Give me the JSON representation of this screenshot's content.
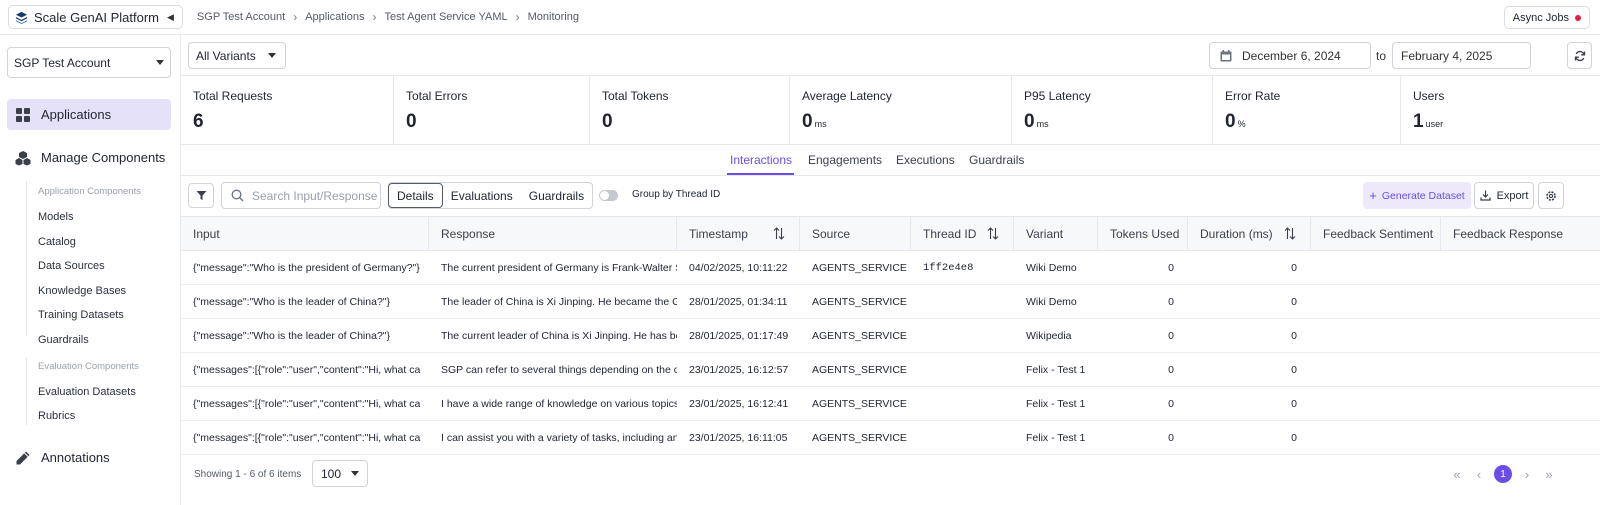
{
  "brand": {
    "name": "Scale GenAI Platform"
  },
  "breadcrumbs": [
    "SGP Test Account",
    "Applications",
    "Test Agent Service YAML",
    "Monitoring"
  ],
  "async_jobs": {
    "label": "Async Jobs"
  },
  "sidebar": {
    "account": "SGP Test Account",
    "applications": "Applications",
    "manage_components": "Manage Components",
    "app_components_header": "Application Components",
    "app_components": [
      "Models",
      "Catalog",
      "Data Sources",
      "Knowledge Bases",
      "Training Datasets",
      "Guardrails"
    ],
    "eval_components_header": "Evaluation Components",
    "eval_components": [
      "Evaluation Datasets",
      "Rubrics"
    ],
    "annotations": "Annotations"
  },
  "filters": {
    "variants": "All Variants",
    "date_from": "December 6, 2024",
    "to_label": "to",
    "date_to": "February 4, 2025"
  },
  "stats": [
    {
      "label": "Total Requests",
      "value": "6",
      "unit": ""
    },
    {
      "label": "Total Errors",
      "value": "0",
      "unit": ""
    },
    {
      "label": "Total Tokens",
      "value": "0",
      "unit": ""
    },
    {
      "label": "Average Latency",
      "value": "0",
      "unit": "ms"
    },
    {
      "label": "P95 Latency",
      "value": "0",
      "unit": "ms"
    },
    {
      "label": "Error Rate",
      "value": "0",
      "unit": "%"
    },
    {
      "label": "Users",
      "value": "1",
      "unit": "user"
    }
  ],
  "tabs": [
    "Interactions",
    "Engagements",
    "Executions",
    "Guardrails"
  ],
  "toolbar": {
    "search_placeholder": "Search Input/Response",
    "segments": [
      "Details",
      "Evaluations",
      "Guardrails"
    ],
    "group_by_label": "Group by Thread ID",
    "generate_label": "Generate Dataset",
    "export_label": "Export"
  },
  "table": {
    "columns": [
      "Input",
      "Response",
      "Timestamp",
      "Source",
      "Thread ID",
      "Variant",
      "Tokens Used",
      "Duration (ms)",
      "Feedback Sentiment",
      "Feedback Response"
    ],
    "rows": [
      [
        "{\"message\":\"Who is the president of Germany?\"}",
        "The current president of Germany is Frank-Walter S",
        "04/02/2025, 10:11:22",
        "AGENTS_SERVICE",
        "1ff2e4e8",
        "Wiki Demo",
        "0",
        "0",
        "",
        ""
      ],
      [
        "{\"message\":\"Who is the leader of China?\"}",
        "The leader of China is Xi Jinping. He became the G",
        "28/01/2025, 01:34:11",
        "AGENTS_SERVICE",
        "",
        "Wiki Demo",
        "0",
        "0",
        "",
        ""
      ],
      [
        "{\"message\":\"Who is the leader of China?\"}",
        "The current leader of China is Xi Jinping. He has be",
        "28/01/2025, 01:17:49",
        "AGENTS_SERVICE",
        "",
        "Wikipedia",
        "0",
        "0",
        "",
        ""
      ],
      [
        "{\"messages\":[{\"role\":\"user\",\"content\":\"Hi, what ca",
        "SGP can refer to several things depending on the c",
        "23/01/2025, 16:12:57",
        "AGENTS_SERVICE",
        "",
        "Felix - Test 1",
        "0",
        "0",
        "",
        ""
      ],
      [
        "{\"messages\":[{\"role\":\"user\",\"content\":\"Hi, what ca",
        "I have a wide range of knowledge on various topics",
        "23/01/2025, 16:12:41",
        "AGENTS_SERVICE",
        "",
        "Felix - Test 1",
        "0",
        "0",
        "",
        ""
      ],
      [
        "{\"messages\":[{\"role\":\"user\",\"content\":\"Hi, what ca",
        "I can assist you with a variety of tasks, including an",
        "23/01/2025, 16:11:05",
        "AGENTS_SERVICE",
        "",
        "Felix - Test 1",
        "0",
        "0",
        "",
        ""
      ]
    ]
  },
  "footer": {
    "showing": "Showing 1 - 6 of 6 items",
    "page_size": "100",
    "current_page": "1"
  },
  "colors": {
    "accent": "#6d4dea",
    "active_nav_bg": "#e5e1f9",
    "status_dot": "#e11d48"
  }
}
